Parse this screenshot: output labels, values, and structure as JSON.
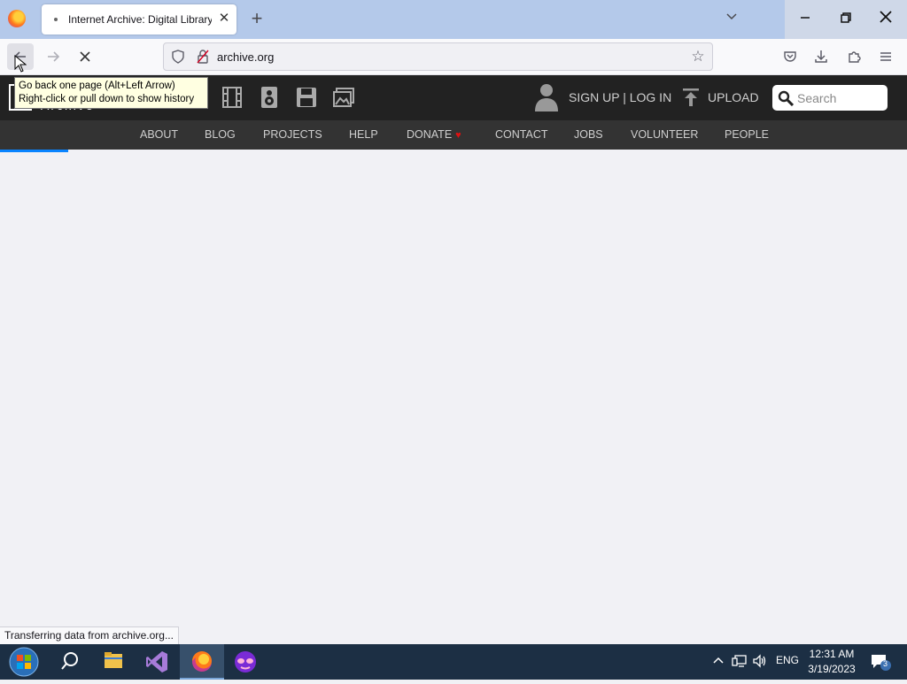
{
  "browser": {
    "tab_title": "Internet Archive: Digital Library",
    "new_tab_symbol": "+",
    "url": "archive.org",
    "tooltip_line1": "Go back one page (Alt+Left Arrow)",
    "tooltip_line2": "Right-click or pull down to show history",
    "status_text": "Transferring data from archive.org..."
  },
  "site": {
    "logo_text": "Archive",
    "signup_label": "SIGN UP | LOG IN",
    "upload_label": "UPLOAD",
    "search_placeholder": "Search",
    "nav": {
      "about": "ABOUT",
      "blog": "BLOG",
      "projects": "PROJECTS",
      "help": "HELP",
      "donate": "DONATE",
      "contact": "CONTACT",
      "jobs": "JOBS",
      "volunteer": "VOLUNTEER",
      "people": "PEOPLE"
    }
  },
  "taskbar": {
    "language": "ENG",
    "time": "12:31 AM",
    "date": "3/19/2023",
    "notification_count": "3"
  },
  "colors": {
    "site_header": "#222222",
    "site_nav": "#333333",
    "loading_bar": "#0a84ff",
    "taskbar": "#1c2f44"
  }
}
